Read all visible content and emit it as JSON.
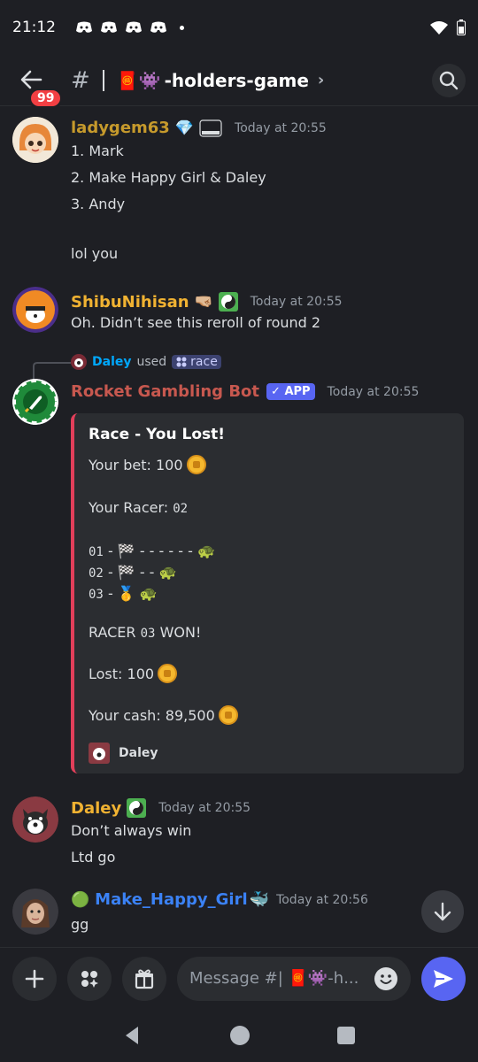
{
  "status": {
    "time": "21:12"
  },
  "header": {
    "back_badge": "99",
    "hash": "#",
    "channel_prefix": "🧧👾",
    "channel_name": "-holders-game",
    "chevron": "›"
  },
  "messages": [
    {
      "author": "ladygem63",
      "author_color": "#c69a2c",
      "timestamp": "Today at 20:55",
      "list": [
        "1.  Mark",
        "2.  Make Happy Girl & Daley",
        "3.  Andy"
      ],
      "text": "lol you"
    },
    {
      "author": "ShibuNihisan",
      "author_color": "#f0b232",
      "timestamp": "Today at 20:55",
      "text": "Oh. Didn’t see this reroll of round 2"
    },
    {
      "reply_user": "Daley",
      "reply_used": "used",
      "reply_command": "race",
      "author": "Rocket Gambling Bot",
      "author_color": "#c7584f",
      "app_tag": "✓ APP",
      "timestamp": "Today at 20:55",
      "embed": {
        "title": "Race - You Lost!",
        "bet_label": "Your bet: 100",
        "racer_label": "Your Racer:",
        "racer_value": "02",
        "race_rows": [
          {
            "num": "01",
            "track": "- 🏁 - - - - - - 🐢"
          },
          {
            "num": "02",
            "track": "- 🏁 - - 🐢"
          },
          {
            "num": "03",
            "track": "- 🥇 🐢"
          }
        ],
        "winner_prefix": "RACER",
        "winner_num": "03",
        "winner_suffix": "WON!",
        "lost_label": "Lost: 100",
        "cash_label": "Your cash: 89,500",
        "footer_user": "Daley",
        "accent": "#e23f5a"
      }
    },
    {
      "author": "Daley",
      "author_color": "#f0b232",
      "timestamp": "Today at 20:55",
      "lines": [
        "Don’t always win",
        "Ltd go"
      ]
    },
    {
      "author": "Make_Happy_Girl",
      "author_prefix": "🟢",
      "author_suffix": "🐳",
      "author_color": "#3b82f6",
      "timestamp": "Today at 20:56",
      "text": "gg"
    }
  ],
  "composer": {
    "placeholder": "Message #| 🧧👾-h..."
  }
}
